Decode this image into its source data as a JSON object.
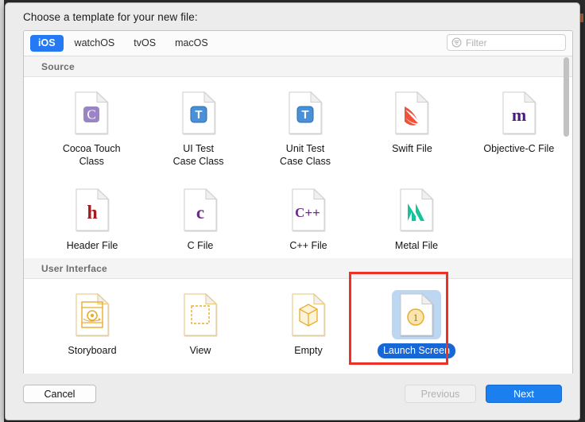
{
  "dialog": {
    "prompt": "Choose a template for your new file:"
  },
  "platform_tabs": [
    {
      "label": "iOS",
      "active": true
    },
    {
      "label": "watchOS",
      "active": false
    },
    {
      "label": "tvOS",
      "active": false
    },
    {
      "label": "macOS",
      "active": false
    }
  ],
  "filter": {
    "placeholder": "Filter",
    "value": "",
    "icon": "filter-circle-icon"
  },
  "sections": [
    {
      "title": "Source",
      "rows": [
        [
          {
            "label": "Cocoa Touch\nClass",
            "icon": "document-cocoa-touch-icon",
            "selected": false
          },
          {
            "label": "UI Test\nCase Class",
            "icon": "document-ui-test-icon",
            "selected": false
          },
          {
            "label": "Unit Test\nCase Class",
            "icon": "document-unit-test-icon",
            "selected": false
          },
          {
            "label": "Swift File",
            "icon": "document-swift-icon",
            "selected": false
          },
          {
            "label": "Objective-C File",
            "icon": "document-objective-c-icon",
            "selected": false
          }
        ],
        [
          {
            "label": "Header File",
            "icon": "document-header-icon",
            "selected": false
          },
          {
            "label": "C File",
            "icon": "document-c-icon",
            "selected": false
          },
          {
            "label": "C++ File",
            "icon": "document-cpp-icon",
            "selected": false
          },
          {
            "label": "Metal File",
            "icon": "document-metal-icon",
            "selected": false
          }
        ]
      ]
    },
    {
      "title": "User Interface",
      "rows": [
        [
          {
            "label": "Storyboard",
            "icon": "document-storyboard-icon",
            "selected": false
          },
          {
            "label": "View",
            "icon": "document-view-icon",
            "selected": false
          },
          {
            "label": "Empty",
            "icon": "document-empty-icon",
            "selected": false
          },
          {
            "label": "Launch Screen",
            "icon": "document-launch-screen-icon",
            "selected": true
          }
        ]
      ]
    }
  ],
  "footer": {
    "cancel_label": "Cancel",
    "previous_label": "Previous",
    "next_label": "Next"
  },
  "colors": {
    "accent_blue": "#1c7ff0",
    "selection_blue": "#1667d8",
    "selection_fill": "#bdd6f2",
    "annotation_red": "#ee3124",
    "swift_orange": "#f05138",
    "metal_green": "#17c39a",
    "interface_gold": "#e8ad2c",
    "objc_purple": "#4b1b7a",
    "header_red": "#a31b21",
    "cocoa_purple": "#9b84c4",
    "test_blue": "#4a90d9"
  }
}
